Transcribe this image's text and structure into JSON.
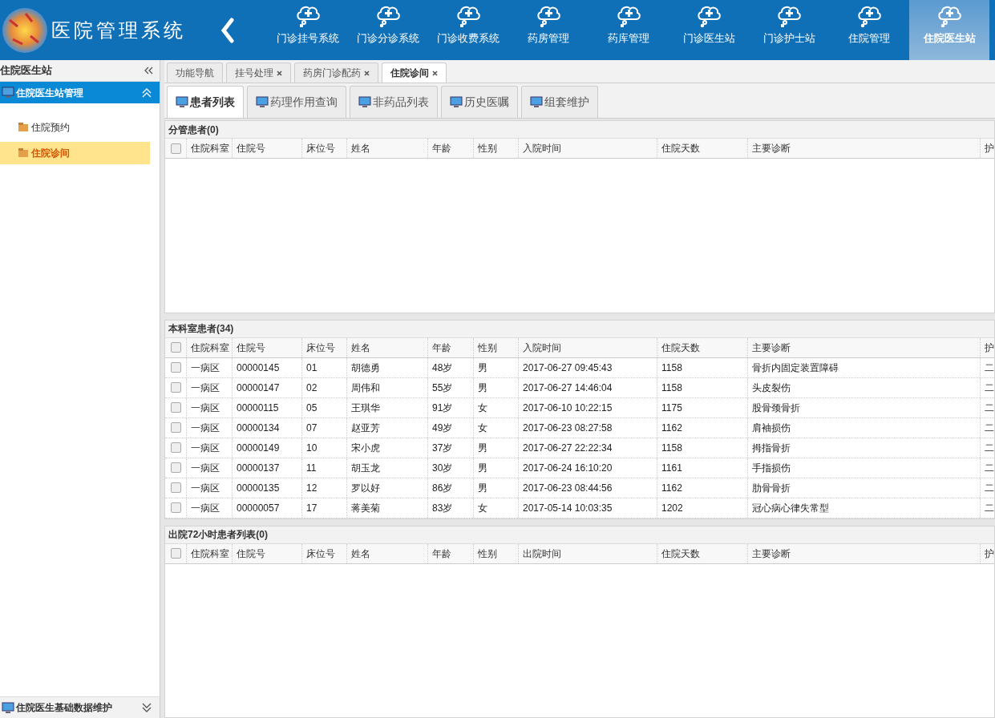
{
  "header": {
    "title": "医院管理系统",
    "nav": [
      {
        "label": "门诊挂号系统",
        "selected": false
      },
      {
        "label": "门诊分诊系统",
        "selected": false
      },
      {
        "label": "门诊收费系统",
        "selected": false
      },
      {
        "label": "药房管理",
        "selected": false
      },
      {
        "label": "药库管理",
        "selected": false
      },
      {
        "label": "门诊医生站",
        "selected": false
      },
      {
        "label": "门诊护士站",
        "selected": false
      },
      {
        "label": "住院管理",
        "selected": false
      },
      {
        "label": "住院医生站",
        "selected": true
      }
    ]
  },
  "sidebar": {
    "title": "住院医生站",
    "groups": [
      {
        "title": "住院医生站管理",
        "expanded": true,
        "items": [
          {
            "label": "住院预约",
            "selected": false
          },
          {
            "label": "住院诊间",
            "selected": true
          }
        ]
      },
      {
        "title": "住院医生基础数据维护",
        "expanded": false
      }
    ]
  },
  "tabs": [
    {
      "label": "功能导航",
      "closable": false,
      "selected": false
    },
    {
      "label": "挂号处理",
      "closable": true,
      "selected": false
    },
    {
      "label": "药房门诊配药",
      "closable": true,
      "selected": false
    },
    {
      "label": "住院诊间",
      "closable": true,
      "selected": true
    }
  ],
  "subtabs": [
    {
      "label": "患者列表",
      "selected": true
    },
    {
      "label": "药理作用查询",
      "selected": false
    },
    {
      "label": "非药品列表",
      "selected": false
    },
    {
      "label": "历史医嘱",
      "selected": false
    },
    {
      "label": "组套维护",
      "selected": false
    }
  ],
  "panels": [
    {
      "title": "分管患者(0)",
      "header_checked": false,
      "columns": [
        "住院科室",
        "住院号",
        "床位号",
        "姓名",
        "年龄",
        "性别",
        "入院时间",
        "住院天数",
        "主要诊断",
        "护"
      ]
    },
    {
      "title": "本科室患者(34)",
      "header_checked": false,
      "columns": [
        "住院科室",
        "住院号",
        "床位号",
        "姓名",
        "年龄",
        "性别",
        "入院时间",
        "住院天数",
        "主要诊断",
        "护"
      ],
      "rows": [
        {
          "checked": false,
          "cells": [
            "一病区",
            "00000145",
            "01",
            "胡德勇",
            "48岁",
            "男",
            "2017-06-27 09:45:43",
            "1158",
            "骨折内固定装置障碍",
            "二"
          ]
        },
        {
          "checked": false,
          "cells": [
            "一病区",
            "00000147",
            "02",
            "周伟和",
            "55岁",
            "男",
            "2017-06-27 14:46:04",
            "1158",
            "头皮裂伤",
            "二"
          ]
        },
        {
          "checked": false,
          "cells": [
            "一病区",
            "00000115",
            "05",
            "王琪华",
            "91岁",
            "女",
            "2017-06-10 10:22:15",
            "1175",
            "股骨颈骨折",
            "二"
          ]
        },
        {
          "checked": false,
          "cells": [
            "一病区",
            "00000134",
            "07",
            "赵亚芳",
            "49岁",
            "女",
            "2017-06-23 08:27:58",
            "1162",
            "肩袖损伤",
            "二"
          ]
        },
        {
          "checked": false,
          "cells": [
            "一病区",
            "00000149",
            "10",
            "宋小虎",
            "37岁",
            "男",
            "2017-06-27 22:22:34",
            "1158",
            "拇指骨折",
            "二"
          ]
        },
        {
          "checked": false,
          "cells": [
            "一病区",
            "00000137",
            "11",
            "胡玉龙",
            "30岁",
            "男",
            "2017-06-24 16:10:20",
            "1161",
            "手指损伤",
            "二"
          ]
        },
        {
          "checked": false,
          "cells": [
            "一病区",
            "00000135",
            "12",
            "罗以好",
            "86岁",
            "男",
            "2017-06-23 08:44:56",
            "1162",
            "肋骨骨折",
            "二"
          ]
        },
        {
          "checked": false,
          "cells": [
            "一病区",
            "00000057",
            "17",
            "蒋美菊",
            "83岁",
            "女",
            "2017-05-14 10:03:35",
            "1202",
            "冠心病心律失常型",
            "二"
          ]
        }
      ]
    },
    {
      "title": "出院72小时患者列表(0)",
      "header_checked": false,
      "columns": [
        "住院科室",
        "住院号",
        "床位号",
        "姓名",
        "年龄",
        "性别",
        "出院时间",
        "住院天数",
        "主要诊断",
        "护"
      ]
    }
  ]
}
